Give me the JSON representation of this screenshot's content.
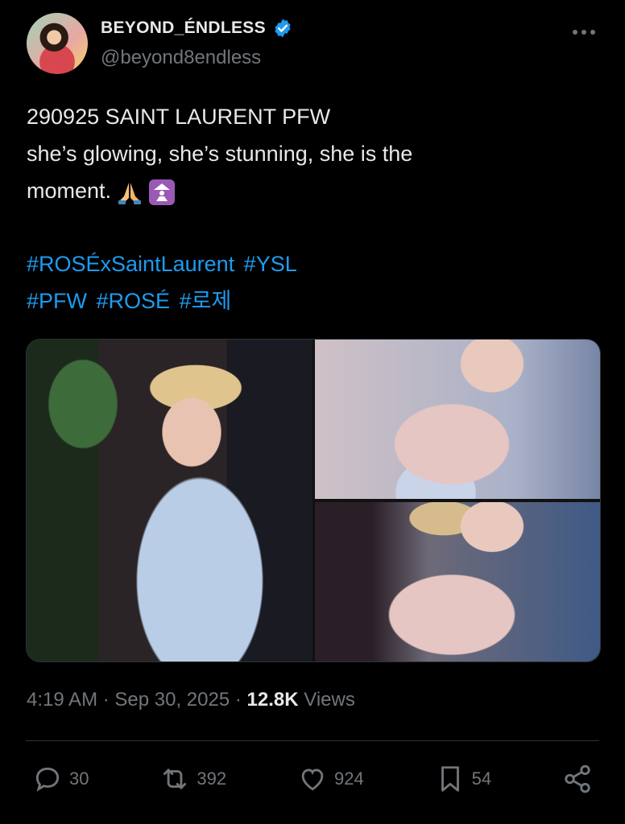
{
  "author": {
    "display_name": "BEYOND_ÉNDLESS",
    "handle": "@beyond8endless",
    "verified": true
  },
  "more_icon": "more-horizontal-icon",
  "tweet": {
    "line1": "290925 SAINT LAURENT PFW",
    "line2": "she’s glowing, she’s stunning, she is the",
    "line3": "moment.",
    "emojis": [
      "folded-hands-emoji",
      "place-of-worship-emoji"
    ],
    "hashtags_line1": [
      "#ROSÉxSaintLaurent",
      "#YSL"
    ],
    "hashtags_line2": [
      "#PFW",
      "#ROSÉ",
      "#로제"
    ]
  },
  "media": {
    "count": 3
  },
  "meta": {
    "time": "4:19 AM",
    "date": "Sep 30, 2025",
    "views_count": "12.8K",
    "views_label": "Views"
  },
  "actions": {
    "replies": "30",
    "reposts": "392",
    "likes": "924",
    "bookmarks": "54"
  },
  "colors": {
    "background": "#000000",
    "text": "#e7e9ea",
    "secondary": "#71767b",
    "accent": "#1d9bf0"
  }
}
